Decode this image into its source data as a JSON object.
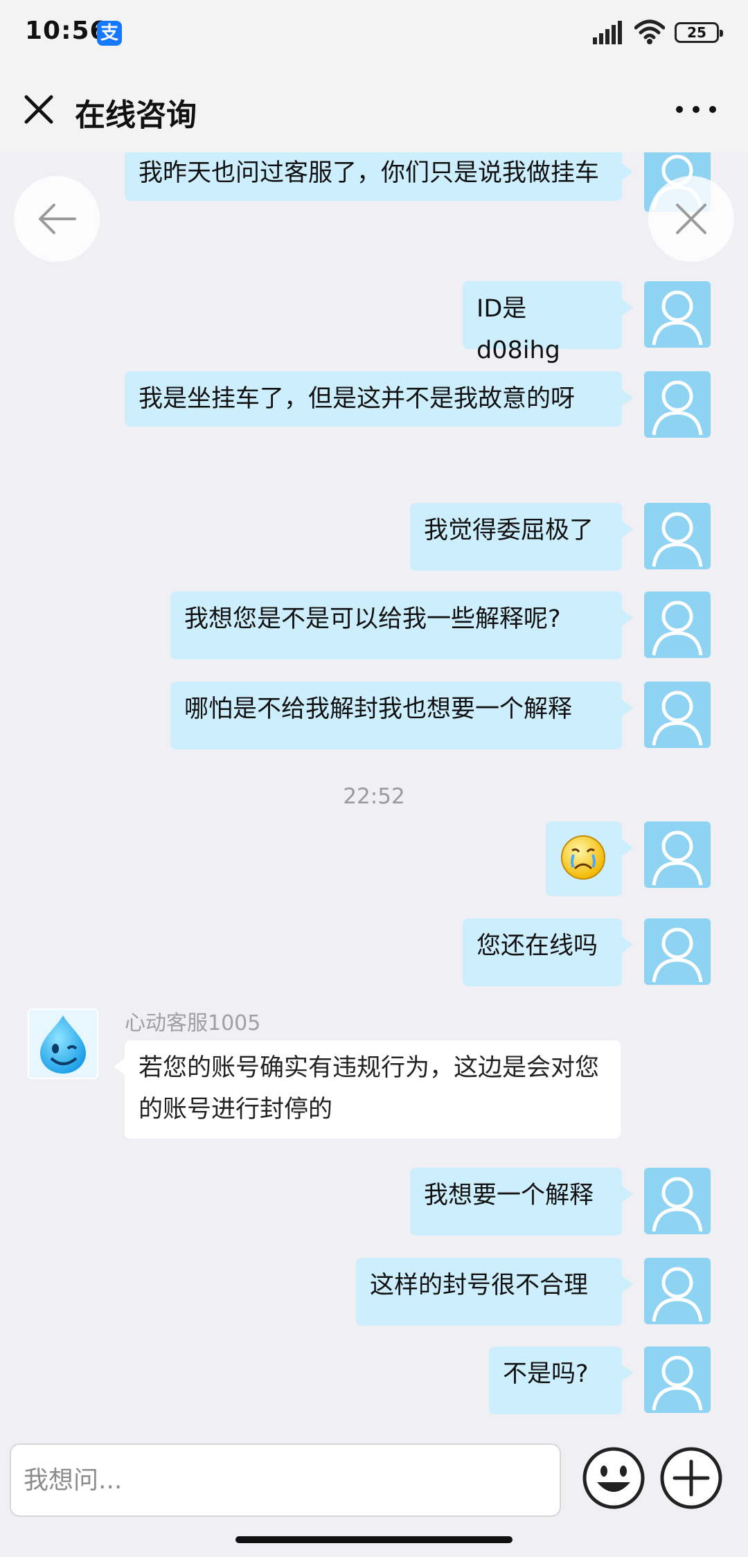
{
  "status_bar": {
    "time": "10:56",
    "app_icon": "alipay-icon",
    "battery": "25"
  },
  "header": {
    "title": "在线咨询",
    "close_icon": "close-icon",
    "more_icon": "more-icon"
  },
  "colors": {
    "user_bubble": "#cdeefc",
    "agent_bubble": "#ffffff",
    "avatar": "#8fd3f3",
    "background": "#efeff4"
  },
  "messages": {
    "m1": "我昨天也问过客服了，你们只是说我做挂车",
    "m2": "ID是d08ihg",
    "m3": "我是坐挂车了，但是这并不是我故意的呀",
    "m4": "我觉得委屈极了",
    "m5": "我想您是不是可以给我一些解释呢?",
    "m6": "哪怕是不给我解封我也想要一个解释",
    "timestamp": "22:52",
    "m7_emoji": "crying-face-emoji",
    "m8": "您还在线吗",
    "agent_name": "心动客服1005",
    "agent_msg": "若您的账号确实有违规行为，这边是会对您的账号进行封停的",
    "m9": "我想要一个解释",
    "m10": "这样的封号很不合理",
    "m11": "不是吗?"
  },
  "input": {
    "placeholder": "我想问..."
  }
}
